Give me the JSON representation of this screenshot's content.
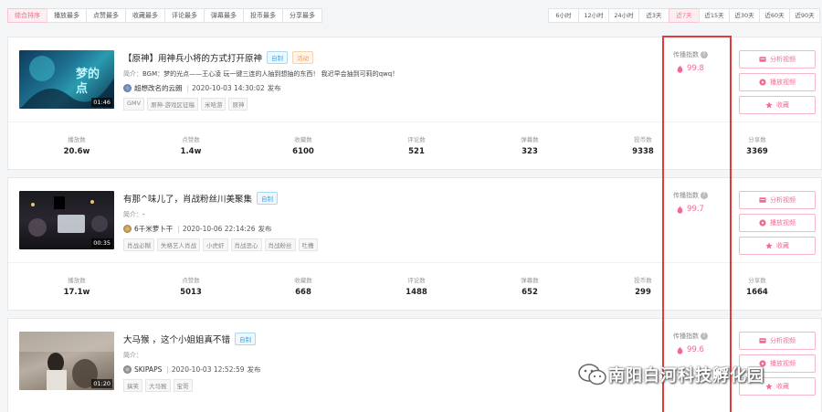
{
  "sort_tabs": [
    {
      "label": "综合排序",
      "active": true
    },
    {
      "label": "播放最多"
    },
    {
      "label": "点赞最多"
    },
    {
      "label": "收藏最多"
    },
    {
      "label": "评论最多"
    },
    {
      "label": "弹幕最多"
    },
    {
      "label": "投币最多"
    },
    {
      "label": "分享最多"
    }
  ],
  "time_tabs": [
    {
      "label": "6小时"
    },
    {
      "label": "12小时"
    },
    {
      "label": "24小时"
    },
    {
      "label": "近3天"
    },
    {
      "label": "近7天",
      "active": true
    },
    {
      "label": "近15天"
    },
    {
      "label": "近30天"
    },
    {
      "label": "近60天"
    },
    {
      "label": "近90天"
    }
  ],
  "labels": {
    "index": "传播指数",
    "desc_prefix": "简介：",
    "publish_suffix": "发布",
    "analyze": "分析视频",
    "play": "播放视频",
    "collect": "收藏",
    "stats": [
      "播放数",
      "点赞数",
      "收藏数",
      "评论数",
      "弹幕数",
      "投币数",
      "分享数"
    ]
  },
  "videos": [
    {
      "title": "【原神】用神兵小将的方式打开原神",
      "badges": [
        "自制",
        "活动"
      ],
      "desc": "BGM：梦的光点——王心凌 玩一键三连的人抽到想抽的东西！ 我迟早会抽到可莉的qwq！",
      "author": "超想改名的云朗",
      "time": "2020-10-03 14:30:02",
      "tags": [
        "GMV",
        "原神-游戏区征稿",
        "米哈游",
        "原神"
      ],
      "duration": "01:46",
      "index": "99.8",
      "stats": [
        "20.6w",
        "1.4w",
        "6100",
        "521",
        "323",
        "9338",
        "3369"
      ]
    },
    {
      "title": "有那^味儿了，肖战粉丝川美聚集",
      "badges": [
        "自制"
      ],
      "desc": "-",
      "author": "6千米萝卜干",
      "time": "2020-10-06 22:14:26",
      "tags": [
        "肖战必糊",
        "失格艺人肖战",
        "小虎虾",
        "肖战恶心",
        "肖战粉丝",
        "吐槽"
      ],
      "duration": "00:35",
      "index": "99.7",
      "stats": [
        "17.1w",
        "5013",
        "668",
        "1488",
        "652",
        "299",
        "1664"
      ]
    },
    {
      "title": "大马猴 ，这个小姐姐真不错",
      "badges": [
        "自制"
      ],
      "desc": "",
      "author": "SKIPAPS",
      "time": "2020-10-03 12:52:59",
      "tags": [
        "搞笑",
        "大马猴",
        "宝哥"
      ],
      "duration": "01:20",
      "index": "99.6",
      "stats": []
    }
  ],
  "watermark": "南阳白河科技孵化园",
  "colors": {
    "accent": "#f06b92",
    "highlight": "#e23b3b",
    "badge_blue": "#3fa7e0",
    "badge_orange": "#f29b4b"
  }
}
